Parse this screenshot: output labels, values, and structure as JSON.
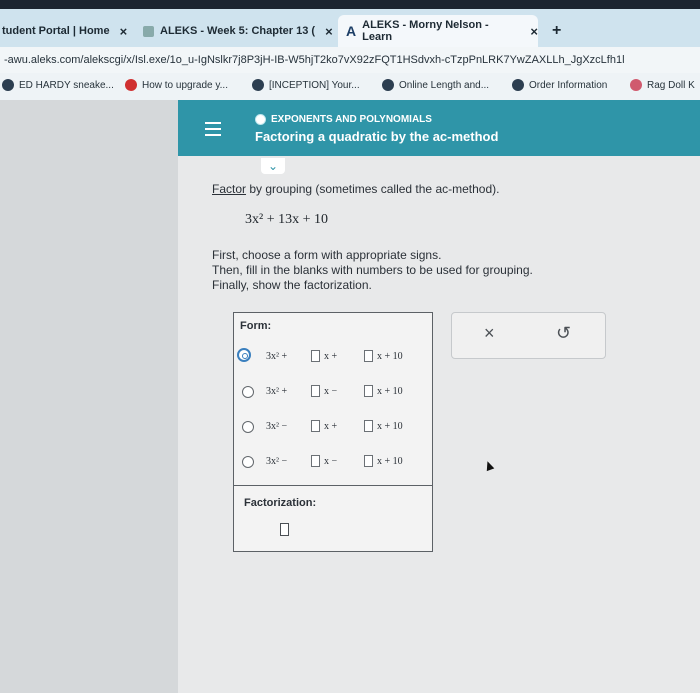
{
  "browser": {
    "tabs": [
      {
        "label": "tudent Portal | Home",
        "close": "×"
      },
      {
        "label": "ALEKS - Week 5: Chapter 13 (",
        "close": "×"
      },
      {
        "label": "ALEKS - Morny Nelson - Learn",
        "close": "×"
      }
    ],
    "new_tab": "+",
    "address": "-awu.aleks.com/alekscgi/x/Isl.exe/1o_u-IgNslkr7j8P3jH-IB-W5hjT2ko7vX92zFQT1HSdvxh-cTzpPnLRK7YwZAXLLh_JgXzcLfh1l",
    "bookmarks": [
      {
        "label": "ED HARDY sneake...",
        "color": "#2c3e50"
      },
      {
        "label": "How to upgrade y...",
        "color": "#d03030"
      },
      {
        "label": "[INCEPTION] Your...",
        "color": "#2c3e50"
      },
      {
        "label": "Online Length and...",
        "color": "#2c3e50"
      },
      {
        "label": "Order Information",
        "color": "#2c3e50"
      },
      {
        "label": "Rag Doll K",
        "color": "#d05a6e"
      }
    ]
  },
  "header": {
    "category": "EXPONENTS AND POLYNOMIALS",
    "title": "Factoring a quadratic by the ac-method"
  },
  "problem": {
    "instruction_link": "Factor",
    "instruction_rest": " by grouping (sometimes called the ac-method).",
    "expression": "3x² + 13x + 10",
    "steps": [
      "First, choose a form with appropriate signs.",
      "Then, fill in the blanks with numbers to be used for grouping.",
      "Finally, show the factorization."
    ]
  },
  "form": {
    "label": "Form:",
    "options": [
      {
        "lead": "3x² +",
        "mid": "x +",
        "end": "x + 10",
        "selected": true
      },
      {
        "lead": "3x² +",
        "mid": "x −",
        "end": "x + 10",
        "selected": false
      },
      {
        "lead": "3x² −",
        "mid": "x +",
        "end": "x + 10",
        "selected": false
      },
      {
        "lead": "3x² −",
        "mid": "x −",
        "end": "x + 10",
        "selected": false
      }
    ],
    "factorization_label": "Factorization:"
  },
  "actions": {
    "clear": "×",
    "undo": "↺"
  },
  "colors": {
    "header": "#2f95a8",
    "tabbar": "#cfe3ee"
  }
}
